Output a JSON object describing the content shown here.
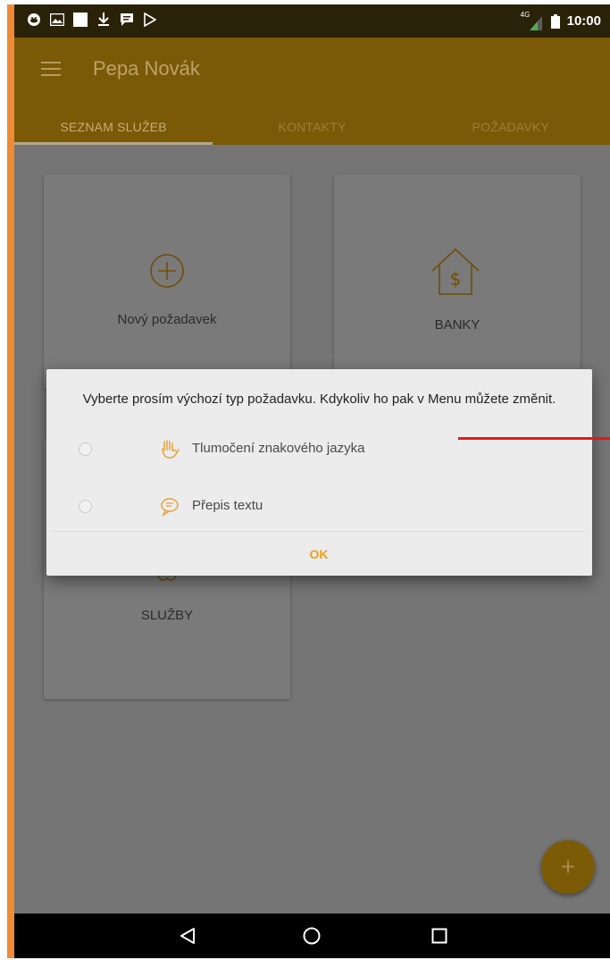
{
  "status_bar": {
    "time": "10:00",
    "network": "4G",
    "left_icons": [
      "notification-app-icon",
      "image-icon",
      "blank-notification-icon",
      "download-icon",
      "message-icon",
      "play-store-icon"
    ]
  },
  "app_bar": {
    "title": "Pepa Novák",
    "menu_icon": "hamburger-menu-icon"
  },
  "tabs": [
    {
      "label": "SEZNAM SLUŽEB",
      "active": true
    },
    {
      "label": "KONTAKTY",
      "active": false
    },
    {
      "label": "POŽADAVKY",
      "active": false
    }
  ],
  "cards": [
    {
      "label": "Nový požadavek",
      "icon": "plus-circle-icon"
    },
    {
      "label": "BANKY",
      "icon": "house-dollar-icon"
    },
    {
      "label": "SLUŽBY",
      "icon": "services-icon"
    }
  ],
  "dialog": {
    "message": "Vyberte prosím výchozí typ požadavku. Kdykoliv ho pak v Menu můžete změnit.",
    "options": [
      {
        "label": "Tlumočení znakového jazyka",
        "icon": "sign-language-hand-icon",
        "selected": false
      },
      {
        "label": "Přepis textu",
        "icon": "speech-bubble-icon",
        "selected": false
      }
    ],
    "ok_label": "OK"
  },
  "fab": {
    "icon": "plus-icon",
    "label": "+"
  },
  "nav_bar": {
    "icons": [
      "back-triangle-icon",
      "home-circle-icon",
      "recents-square-icon"
    ]
  },
  "colors": {
    "primary": "#7a5a06",
    "accent": "#e8a11b",
    "icon_orange": "#e6a23c",
    "annotation_red": "#e5161b"
  }
}
